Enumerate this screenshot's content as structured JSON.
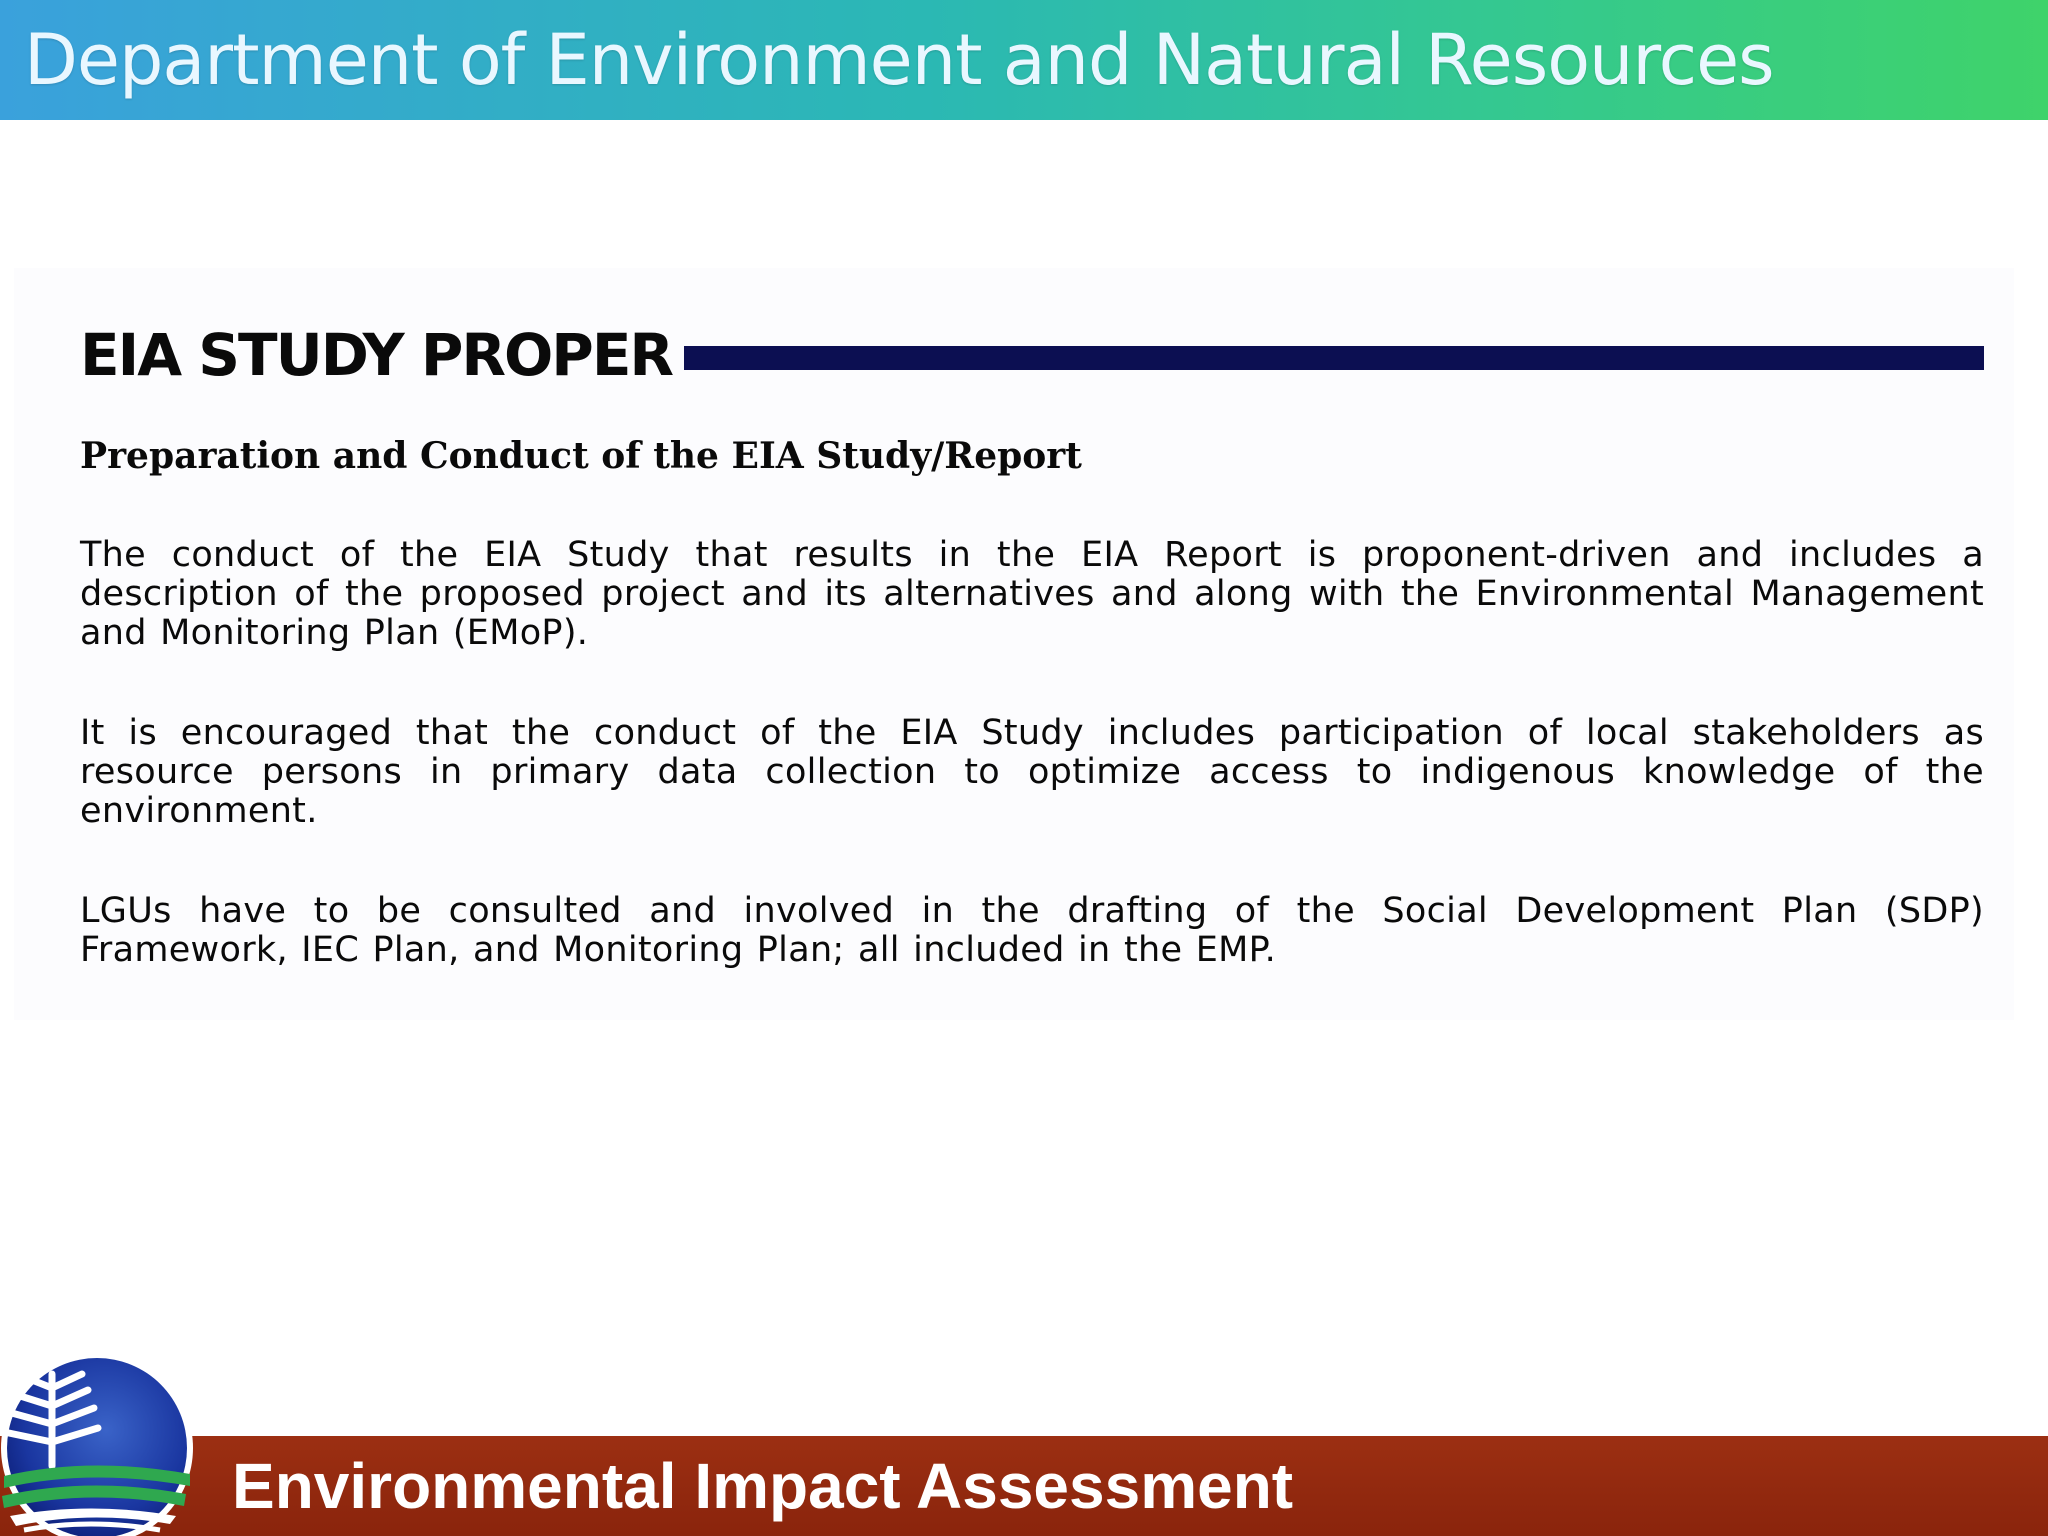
{
  "header": {
    "title": "Department of Environment and Natural Resources"
  },
  "section": {
    "title": "EIA STUDY PROPER",
    "subheading": "Preparation and Conduct of the EIA Study/Report",
    "paragraphs": [
      "The conduct of the EIA Study that results in the EIA Report is proponent-driven and includes a description of the proposed project and its alternatives and along with the Environmental Management and Monitoring Plan (EMoP).",
      "It is encouraged that the conduct of the EIA Study includes participation of local stakeholders as resource persons in primary data collection to optimize access to indigenous knowledge of the environment.",
      "LGUs have to be consulted and involved in the drafting of the Social Development Plan (SDP) Framework, IEC Plan, and Monitoring Plan; all included in the EMP."
    ]
  },
  "footer": {
    "title": "Environmental Impact Assessment",
    "logo_icon": "denr-seal-icon"
  },
  "colors": {
    "header_gradient_start": "#3aa1dc",
    "header_gradient_end": "#3fd36a",
    "title_rule": "#0c0f52",
    "footer_band": "#8a240c"
  }
}
